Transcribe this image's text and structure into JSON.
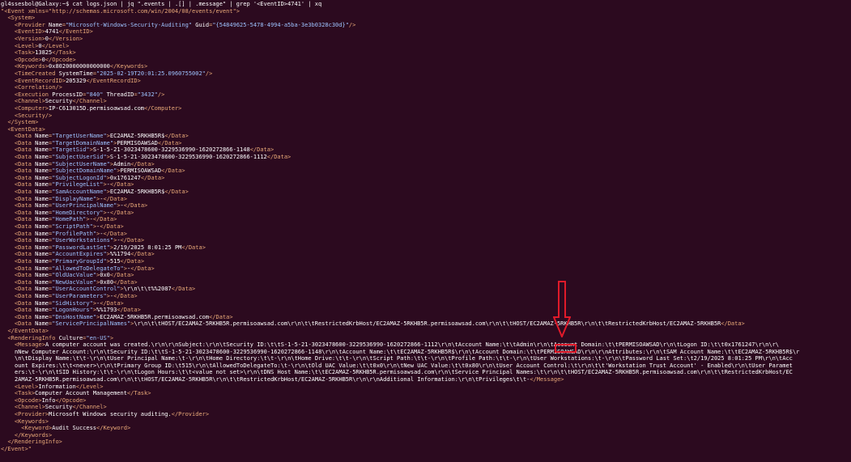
{
  "terminal": {
    "prompt": "gl4ssesbol@Galaxy:~$",
    "command": " cat logs.json | jq \".events | .[] | .message\" | grep '<EventID>4741' | xq",
    "event_open_tag": "\"<Event xmlns=\"http://schemas.microsoft.com/win/2004/08/events/event\">",
    "event_close": "</Event>\""
  },
  "system": {
    "provider_name": "Microsoft-Windows-Security-Auditing",
    "provider_guid": "{54849625-5478-4994-a5ba-3e3b0328c30d}",
    "event_id": "4741",
    "version": "0",
    "level": "0",
    "task": "13825",
    "opcode": "0",
    "keywords": "0x8020000000000000",
    "time_created": "2025-02-19T20:01:25.0960755002",
    "event_record_id": "205329",
    "process_id": "840",
    "thread_id": "3432",
    "channel": "Security",
    "computer": "IP-C613015D.permisoawsad.com"
  },
  "event_data": [
    {
      "name": "TargetUserName",
      "value": "EC2AMAZ-5RKHB5R$"
    },
    {
      "name": "TargetDomainName",
      "value": "PERMISOAWSAD"
    },
    {
      "name": "TargetSid",
      "value": "S-1-5-21-3023478600-3229536990-1620272866-1148"
    },
    {
      "name": "SubjectUserSid",
      "value": "S-1-5-21-3023478600-3229536990-1620272866-1112"
    },
    {
      "name": "SubjectUserName",
      "value": "Admin"
    },
    {
      "name": "SubjectDomainName",
      "value": "PERMISOAWSAD"
    },
    {
      "name": "SubjectLogonId",
      "value": "0x1761247"
    },
    {
      "name": "PrivilegeList",
      "value": "-"
    },
    {
      "name": "SamAccountName",
      "value": "EC2AMAZ-5RKHB5R$"
    },
    {
      "name": "DisplayName",
      "value": "-"
    },
    {
      "name": "UserPrincipalName",
      "value": "-"
    },
    {
      "name": "HomeDirectory",
      "value": "-"
    },
    {
      "name": "HomePath",
      "value": "-"
    },
    {
      "name": "ScriptPath",
      "value": "-"
    },
    {
      "name": "ProfilePath",
      "value": "-"
    },
    {
      "name": "UserWorkstations",
      "value": "-"
    },
    {
      "name": "PasswordLastSet",
      "value": "2/19/2025 8:01:25 PM"
    },
    {
      "name": "AccountExpires",
      "value": "%%1794"
    },
    {
      "name": "PrimaryGroupId",
      "value": "515"
    },
    {
      "name": "AllowedToDelegateTo",
      "value": "-"
    },
    {
      "name": "OldUacValue",
      "value": "0x0"
    },
    {
      "name": "NewUacValue",
      "value": "0x80"
    },
    {
      "name": "UserAccountControl",
      "value": "\\r\\n\\t\\t%%2087"
    },
    {
      "name": "UserParameters",
      "value": "-"
    },
    {
      "name": "SidHistory",
      "value": "-"
    },
    {
      "name": "LogonHours",
      "value": "%%1793"
    },
    {
      "name": "DnsHostName",
      "value": "EC2AMAZ-5RKHB5R.permisoawsad.com"
    },
    {
      "name": "ServicePrincipalNames",
      "value": "\\r\\n\\t\\tHOST/EC2AMAZ-5RKHB5R.permisoawsad.com\\r\\n\\t\\tRestrictedKrbHost/EC2AMAZ-5RKHB5R.permisoawsad.com\\r\\n\\t\\tHOST/EC2AMAZ-5RKHB5R\\r\\n\\t\\tRestrictedKrbHost/EC2AMAZ-5RKHB5R"
    }
  ],
  "rendering": {
    "culture": "en-US",
    "message_lines": [
      "A computer account was created.\\r\\n\\r\\nSubject:\\r\\n\\tSecurity ID:\\t\\tS-1-5-21-3023478600-3229536990-1620272866-1112\\r\\n\\tAccount Name:\\t\\tAdmin\\r\\n\\tAccount Domain:\\t\\tPERMISOAWSAD\\r\\n\\tLogon ID:\\t\\t0x1761247\\r\\n\\r\\",
      "nNew Computer Account:\\r\\n\\tSecurity ID:\\t\\tS-1-5-21-3023478600-3229536990-1620272866-1148\\r\\n\\tAccount Name:\\t\\tEC2AMAZ-5RKHB5R$\\r\\n\\tAccount Domain:\\t\\tPERMISOAWSAD\\r\\n\\r\\nAttributes:\\r\\n\\tSAM Account Name:\\t\\tEC2AMAZ-5RKHB5R$\\r",
      "\\n\\tDisplay Name:\\t\\t-\\r\\n\\tUser Principal Name:\\t-\\r\\n\\tHome Directory:\\t\\t-\\r\\n\\tHome Drive:\\t\\t-\\r\\n\\tScript Path:\\t\\t-\\r\\n\\tProfile Path:\\t\\t-\\r\\n\\tUser Workstations:\\t-\\r\\n\\tPassword Last Set:\\t2/19/2025 8:01:25 PM\\r\\n\\tAcc",
      "ount Expires:\\t\\t<never>\\r\\n\\tPrimary Group ID:\\t515\\r\\n\\tAllowedToDelegateTo:\\t-\\r\\n\\tOld UAC Value:\\t\\t0x0\\r\\n\\tNew UAC Value:\\t\\t0x80\\r\\n\\tUser Account Control:\\t\\r\\n\\t\\t'Workstation Trust Account' - Enabled\\r\\n\\tUser Paramet",
      "ers:\\t-\\r\\n\\tSID History:\\t\\t-\\r\\n\\tLogon Hours:\\t\\t<value not set>\\r\\n\\tDNS Host Name:\\t\\tEC2AMAZ-5RKHB5R.permisoawsad.com\\r\\n\\tService Principal Names:\\t\\r\\n\\t\\tHOST/EC2AMAZ-5RKHB5R.permisoawsad.com\\r\\n\\t\\tRestrictedKrbHost/EC",
      "2AMAZ-5RKHB5R.permisoawsad.com\\r\\n\\t\\tHOST/EC2AMAZ-5RKHB5R\\r\\n\\t\\tRestrictedKrbHost/EC2AMAZ-5RKHB5R\\r\\n\\r\\nAdditional Information:\\r\\n\\tPrivileges\\t\\t-"
    ],
    "level": "Information",
    "task": "Computer Account Management",
    "opcode": "Info",
    "channel": "Security",
    "provider": "Microsoft Windows security auditing.",
    "keyword": "Audit Success"
  },
  "colors": {
    "background": "#2c0a1f",
    "tag": "#e8a878",
    "string": "#9ec3ff",
    "annotation": "#e01a2a"
  }
}
